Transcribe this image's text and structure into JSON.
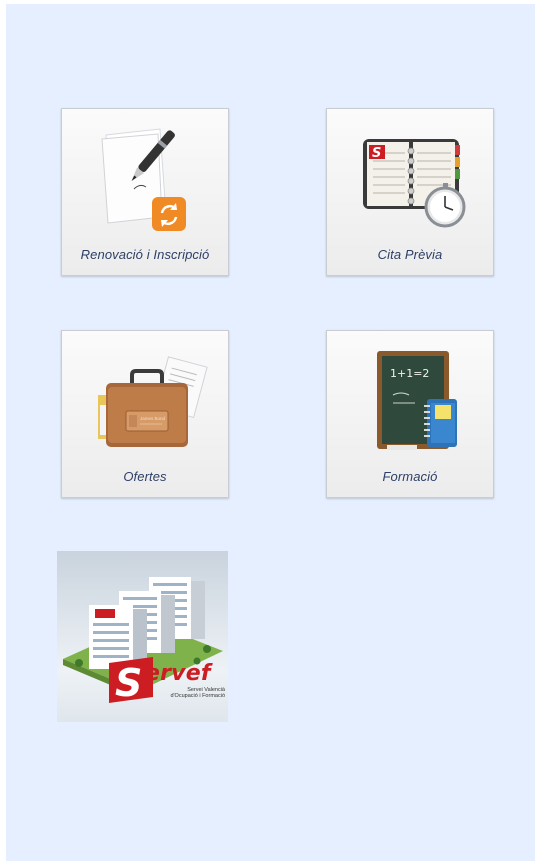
{
  "tiles": [
    {
      "label": "Renovació i Inscripció",
      "icon": "pen-document-renew-icon"
    },
    {
      "label": "Cita Prèvia",
      "icon": "agenda-clock-icon"
    },
    {
      "label": "Ofertes",
      "icon": "briefcase-icon"
    },
    {
      "label": "Formació",
      "icon": "chalkboard-book-icon"
    }
  ],
  "chalkboard_text": "1+1=2",
  "logo": {
    "word": "ervef",
    "letter": "S",
    "subtitle_line1": "Servei Valencià",
    "subtitle_line2": "d'Ocupació i Formació"
  },
  "colors": {
    "background": "#e6efff",
    "label": "#2d3f66",
    "brand_red": "#cc1d23",
    "renew_orange": "#f08a24"
  }
}
